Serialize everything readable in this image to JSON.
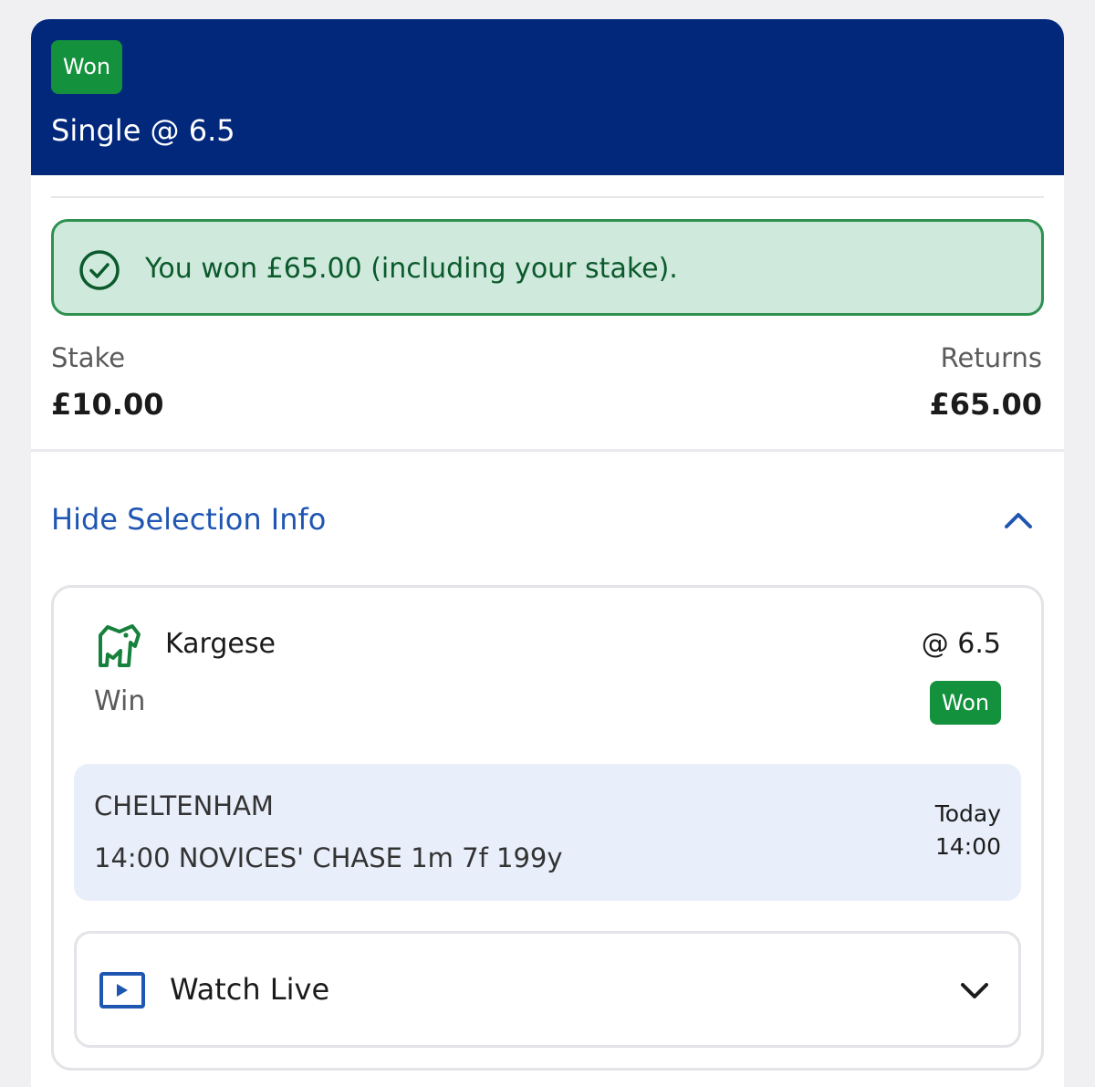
{
  "header": {
    "status_badge": "Won",
    "title": "Single @ 6.5",
    "background_color": "#02287c",
    "badge_color": "#13913d"
  },
  "win_banner": {
    "icon": "check-circle-icon",
    "message": "You won £65.00 (including your stake)."
  },
  "summary": {
    "stake_label": "Stake",
    "stake_value": "£10.00",
    "returns_label": "Returns",
    "returns_value": "£65.00"
  },
  "selection_toggle": {
    "label": "Hide Selection Info",
    "icon": "chevron-up-icon",
    "link_color": "#1f56b2"
  },
  "selection": {
    "icon": "horse-silk-icon",
    "runner": "Kargese",
    "odds": "@ 6.5",
    "bet_type": "Win",
    "status_badge": "Won",
    "race": {
      "venue": "CHELTENHAM",
      "name": "14:00 NOVICES' CHASE 1m 7f 199y",
      "day": "Today",
      "time": "14:00"
    }
  },
  "watch_live": {
    "icon": "play-icon",
    "label": "Watch Live",
    "chevron": "chevron-down-icon"
  }
}
